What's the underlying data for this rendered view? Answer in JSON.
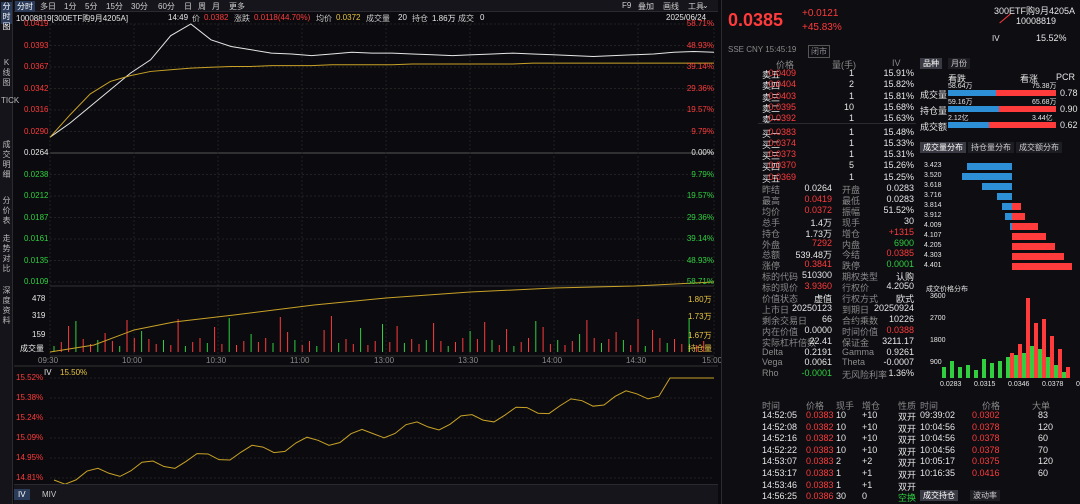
{
  "side_tabs": [
    "分时图",
    "K线图",
    "TICK",
    "成交明细",
    "分价表",
    "走势对比",
    "深度资料"
  ],
  "toolbar": {
    "items": [
      "分时",
      "多日",
      "1分",
      "5分",
      "15分",
      "30分",
      "60分",
      "日",
      "周",
      "月",
      "更多"
    ],
    "right": [
      "F9",
      "叠加",
      "画线",
      "工具",
      "⌄"
    ]
  },
  "info": {
    "code_name": "10008819[300ETF购9月4205A]",
    "time": "14:49",
    "price_label": "价",
    "price": "0.0382",
    "chg_label": "涨跌",
    "chg": "0.0118(44.70%)",
    "avg_label": "均价",
    "avg": "0.0372",
    "vol_label": "成交量",
    "vol": "20",
    "oi_label": "持仓",
    "oi": "1.86万",
    "cur_label": "成交",
    "cur": "0",
    "date": "2025/06/24"
  },
  "price_axis_left": [
    "0.0419",
    "0.0393",
    "0.0367",
    "0.0342",
    "0.0316",
    "0.0290",
    "0.0264",
    "0.0238",
    "0.0212",
    "0.0187",
    "0.0161",
    "0.0135",
    "0.0109"
  ],
  "price_axis_right": [
    "58.71%",
    "48.93%",
    "39.14%",
    "29.36%",
    "19.57%",
    "9.79%",
    "0.00%",
    "9.79%",
    "19.57%",
    "29.36%",
    "39.14%",
    "48.93%",
    "58.71%"
  ],
  "vol_axis_left": [
    "478",
    "319",
    "159",
    "成交量"
  ],
  "vol_axis_right": [
    "1.80万",
    "1.73万",
    "1.67万",
    "持仓量"
  ],
  "time_axis": [
    "09:30",
    "10:00",
    "10:30",
    "11:00",
    "13:00",
    "13:30",
    "14:00",
    "14:30",
    "15:00"
  ],
  "iv_panel": {
    "label": "IV",
    "value": "15.50%",
    "axis": [
      "15.52%",
      "15.38%",
      "15.24%",
      "15.09%",
      "14.95%",
      "14.81%"
    ]
  },
  "bottom_tabs": [
    "IV",
    "MIV"
  ],
  "quote": {
    "price": "0.0385",
    "chg": "+0.0121",
    "pct": "+45.83%",
    "name": "300ETF购9月4205A",
    "code": "10008819",
    "tag": "IV",
    "iv": "15.52%",
    "exchange": "SSE  CNY  15:45:19",
    "status": "闭市"
  },
  "orderbook": {
    "headers": [
      "价格",
      "量(手)",
      "IV"
    ],
    "asks": [
      {
        "l": "卖五",
        "p": "0.0409",
        "v": "1",
        "iv": "15.91%"
      },
      {
        "l": "卖四",
        "p": "0.0404",
        "v": "2",
        "iv": "15.82%"
      },
      {
        "l": "卖三",
        "p": "0.0403",
        "v": "1",
        "iv": "15.81%"
      },
      {
        "l": "卖二",
        "p": "0.0395",
        "v": "10",
        "iv": "15.68%"
      },
      {
        "l": "卖一",
        "p": "0.0392",
        "v": "1",
        "iv": "15.63%"
      }
    ],
    "bids": [
      {
        "l": "买一",
        "p": "0.0383",
        "v": "1",
        "iv": "15.48%"
      },
      {
        "l": "买二",
        "p": "0.0374",
        "v": "1",
        "iv": "15.33%"
      },
      {
        "l": "买三",
        "p": "0.0373",
        "v": "1",
        "iv": "15.31%"
      },
      {
        "l": "买四",
        "p": "0.0370",
        "v": "5",
        "iv": "15.26%"
      },
      {
        "l": "买五",
        "p": "0.0369",
        "v": "1",
        "iv": "15.25%"
      }
    ]
  },
  "stats": [
    [
      "昨结",
      "0.0264",
      "开盘",
      "0.0283"
    ],
    [
      "最高",
      "0.0419",
      "最低",
      "0.0283"
    ],
    [
      "均价",
      "0.0372",
      "振幅",
      "51.52%"
    ],
    [
      "总手",
      "1.4万",
      "现手",
      "30"
    ],
    [
      "持仓",
      "1.73万",
      "增仓",
      "+1315"
    ],
    [
      "外盘",
      "7292",
      "内盘",
      "6900"
    ],
    [
      "总额",
      "539.48万",
      "今结",
      "0.0385"
    ],
    [
      "涨停",
      "0.3841",
      "跌停",
      "0.0001"
    ],
    [
      "标的代码",
      "510300",
      "期权类型",
      "认购"
    ],
    [
      "标的现价",
      "3.9360",
      "行权价",
      "4.2050"
    ],
    [
      "价值状态",
      "虚值",
      "行权方式",
      "欧式"
    ],
    [
      "上市日",
      "20250123",
      "到期日",
      "20250924"
    ],
    [
      "剩余交易日",
      "66",
      "合约乘数",
      "10226"
    ],
    [
      "内在价值",
      "0.0000",
      "时间价值",
      "0.0388"
    ],
    [
      "实际杠杆倍数",
      "22.41",
      "保证金",
      "3211.17"
    ],
    [
      "Delta",
      "0.2191",
      "Gamma",
      "0.9261"
    ],
    [
      "Vega",
      "0.0061",
      "Theta",
      "-0.0007"
    ],
    [
      "Rho",
      "-0.0001",
      "无风险利率",
      "1.36%"
    ]
  ],
  "trades": {
    "headers": [
      "时间",
      "价格",
      "现手",
      "增仓",
      "性质"
    ],
    "rows": [
      [
        "14:52:05",
        "0.0383",
        "10",
        "+10",
        "双开"
      ],
      [
        "14:52:08",
        "0.0382",
        "10",
        "+10",
        "双开"
      ],
      [
        "14:52:16",
        "0.0382",
        "10",
        "+10",
        "双开"
      ],
      [
        "14:52:22",
        "0.0383",
        "10",
        "+10",
        "双开"
      ],
      [
        "14:53:07",
        "0.0383",
        "2",
        "+2",
        "双开"
      ],
      [
        "14:53:17",
        "0.0383",
        "1",
        "+1",
        "双开"
      ],
      [
        "14:53:46",
        "0.0383",
        "1",
        "+1",
        "双开"
      ],
      [
        "14:56:25",
        "0.0386",
        "30",
        "0",
        "空换"
      ]
    ]
  },
  "pcr": {
    "tabs": [
      "品种",
      "月份"
    ],
    "headers": [
      "看跌",
      "看涨",
      "PCR"
    ],
    "rows": [
      {
        "label": "成交量",
        "put": "58.64万",
        "call": "75.38万",
        "pcr": "0.78",
        "put_frac": 0.44
      },
      {
        "label": "持仓量",
        "put": "59.16万",
        "call": "65.68万",
        "pcr": "0.90",
        "put_frac": 0.47
      },
      {
        "label": "成交额",
        "put": "2.12亿",
        "call": "3.44亿",
        "pcr": "0.62",
        "put_frac": 0.38
      }
    ]
  },
  "dist_tabs": [
    "成交量分布",
    "持仓量分布",
    "成交额分布"
  ],
  "dist": {
    "labels": [
      "3.423",
      "3.520",
      "3.618",
      "3.716",
      "3.814",
      "3.912",
      "4.009",
      "4.107",
      "4.205",
      "4.303",
      "4.401"
    ],
    "put": [
      18,
      20,
      12,
      6,
      4,
      3,
      1,
      0,
      0,
      0,
      0
    ],
    "call": [
      0,
      0,
      0,
      0,
      2,
      3,
      6,
      8,
      10,
      12,
      14
    ]
  },
  "price_dist": {
    "title": "成交价格分布",
    "y_axis": [
      "3600",
      "2700",
      "1800",
      "900"
    ],
    "x_axis": [
      "0.0283",
      "0.0315",
      "0.0346",
      "0.0378",
      "0.0409"
    ],
    "bars": [
      {
        "g": 500,
        "r": 0
      },
      {
        "g": 800,
        "r": 0
      },
      {
        "g": 500,
        "r": 0
      },
      {
        "g": 600,
        "r": 0
      },
      {
        "g": 400,
        "r": 0
      },
      {
        "g": 900,
        "r": 0
      },
      {
        "g": 700,
        "r": 0
      },
      {
        "g": 800,
        "r": 0
      },
      {
        "g": 1000,
        "r": 1200
      },
      {
        "g": 1100,
        "r": 1600
      },
      {
        "g": 1200,
        "r": 3800
      },
      {
        "g": 1500,
        "r": 2600
      },
      {
        "g": 1400,
        "r": 2800
      },
      {
        "g": 1000,
        "r": 2000
      },
      {
        "g": 600,
        "r": 1400
      },
      {
        "g": 300,
        "r": 500
      }
    ]
  },
  "big": {
    "headers": [
      "时间",
      "价格",
      "大单"
    ],
    "rows": [
      [
        "09:39:02",
        "0.0302",
        "83"
      ],
      [
        "10:04:56",
        "0.0378",
        "120"
      ],
      [
        "10:04:56",
        "0.0378",
        "60"
      ],
      [
        "10:04:56",
        "0.0378",
        "70"
      ],
      [
        "10:05:17",
        "0.0375",
        "120"
      ],
      [
        "10:16:35",
        "0.0416",
        "60"
      ]
    ]
  },
  "bottom_right_tabs": [
    "成交持仓",
    "波动率"
  ],
  "chart_data": {
    "type": "line",
    "series": [
      {
        "values": [
          0.0283,
          0.03,
          0.032,
          0.034,
          0.036,
          0.0376,
          0.0405,
          0.0419,
          0.04,
          0.0392,
          0.0388,
          0.0384,
          0.0383,
          0.0381,
          0.0383,
          0.0385,
          0.0384,
          0.0384,
          0.0383,
          0.0382,
          0.0381,
          0.0382,
          0.0383,
          0.0384,
          0.0383,
          0.0382,
          0.0381,
          0.038,
          0.0381,
          0.0382,
          0.0383,
          0.0385,
          0.0386,
          0.0385
        ]
      },
      {
        "values": [
          0.0283,
          0.031,
          0.0335,
          0.035,
          0.0357,
          0.0362,
          0.0364,
          0.0366,
          0.0367,
          0.0368,
          0.0368,
          0.0369,
          0.0369,
          0.0369,
          0.037,
          0.037,
          0.037,
          0.037,
          0.0371,
          0.0371,
          0.0371,
          0.0371,
          0.0371,
          0.0371,
          0.0372,
          0.0372,
          0.0372,
          0.0372,
          0.0372,
          0.0372,
          0.0372,
          0.0372,
          0.0372,
          0.0372
        ]
      }
    ],
    "ylim": [
      0.0109,
      0.0419
    ]
  }
}
